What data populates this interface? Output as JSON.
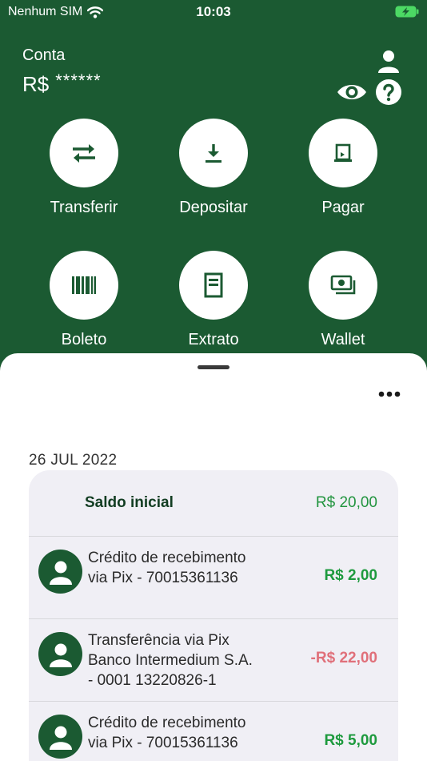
{
  "status_bar": {
    "carrier": "Nenhum SIM",
    "time": "10:03"
  },
  "header": {
    "account_label": "Conta",
    "currency": "R$",
    "masked_balance": "******"
  },
  "actions": [
    {
      "label": "Transferir",
      "icon": "transfer-icon"
    },
    {
      "label": "Depositar",
      "icon": "deposit-icon"
    },
    {
      "label": "Pagar",
      "icon": "pay-icon"
    },
    {
      "label": "Boleto",
      "icon": "barcode-icon"
    },
    {
      "label": "Extrato",
      "icon": "statement-icon"
    },
    {
      "label": "Wallet",
      "icon": "wallet-icon"
    }
  ],
  "statement": {
    "date": "26 JUL 2022",
    "initial_label": "Saldo inicial",
    "initial_value": "R$ 20,00",
    "transactions": [
      {
        "description": "Crédito de recebimento via Pix - 70015361136",
        "amount": "R$ 2,00",
        "type": "credit"
      },
      {
        "description": "Transferência via Pix Banco Intermedium S.A. - 0001 13220826-1",
        "amount": "-R$ 22,00",
        "type": "debit"
      },
      {
        "description": "Crédito de recebimento via Pix - 70015361136",
        "amount": "R$ 5,00",
        "type": "credit"
      }
    ]
  },
  "colors": {
    "brand_green": "#1b5a32",
    "credit": "#1e9a3e",
    "debit": "#e0707a",
    "card_bg": "#f0eff5"
  }
}
